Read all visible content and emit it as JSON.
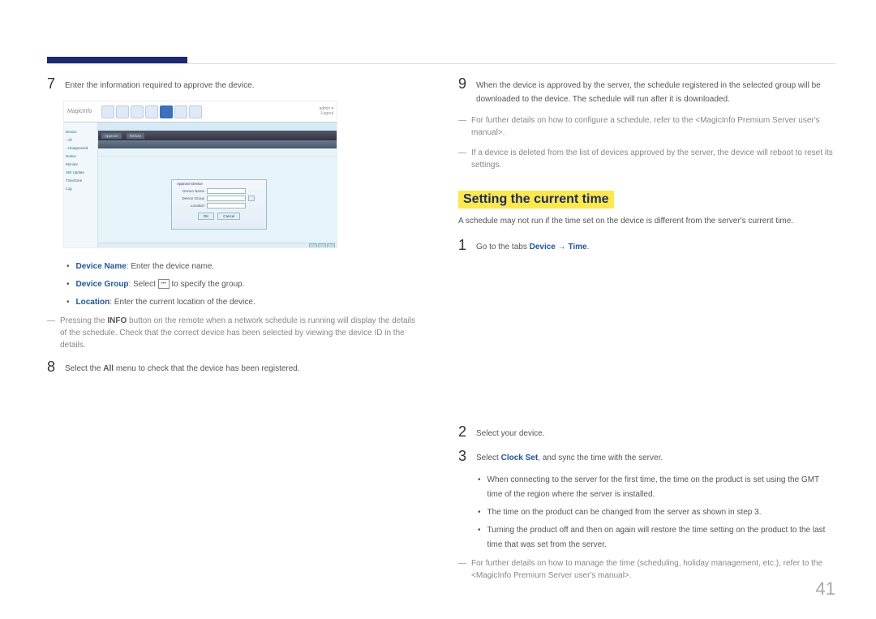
{
  "pageNumber": "41",
  "left": {
    "step7": {
      "num": "7",
      "text": "Enter the information required to approve the device."
    },
    "ss": {
      "logo": "MagicInfo",
      "sideItems": [
        "Device",
        "- All",
        "- Unapproved",
        "Notice",
        "Monitor",
        "SW Update",
        "TimeZone",
        "Log"
      ],
      "dlg": {
        "title": "Approve Device",
        "rows": [
          {
            "label": "Device Name"
          },
          {
            "label": "Device Group"
          },
          {
            "label": "Location"
          }
        ],
        "btnOk": "OK",
        "btnCancel": "Cancel"
      }
    },
    "bullets": {
      "deviceNameLabel": "Device Name",
      "deviceNameText": ": Enter the device name.",
      "deviceGroupLabel": "Device Group",
      "deviceGroupText1": ": Select ",
      "deviceGroupText2": " to specify the group.",
      "locationLabel": "Location",
      "locationText": ": Enter the current location of the device."
    },
    "note1a": "Pressing the ",
    "note1b": "INFO",
    "note1c": " button on the remote when a network schedule is running will display the details of the schedule. Check that the correct device has been selected by viewing the device ID in the details.",
    "step8": {
      "num": "8",
      "pre": "Select the ",
      "bold": "All",
      "post": " menu to check that the device has been registered."
    }
  },
  "right": {
    "step9": {
      "num": "9",
      "text": "When the device is approved by the server, the schedule registered in the selected group will be downloaded to the device. The schedule will run after it is downloaded."
    },
    "note2": "For further details on how to configure a schedule, refer to the <MagicInfo Premium Server user's manual>.",
    "note3": "If a device is deleted from the list of devices approved by the server, the device will reboot to reset its settings.",
    "sectionTitle": "Setting the current time",
    "intro": "A schedule may not run if the time set on the device is different from the server's current time.",
    "step1": {
      "num": "1",
      "pre": "Go to the tabs ",
      "b1": "Device",
      "arrow": " → ",
      "b2": "Time",
      "post": "."
    },
    "step2": {
      "num": "2",
      "text": "Select your device."
    },
    "step3": {
      "num": "3",
      "pre": "Select ",
      "bold": "Clock Set",
      "post": ", and sync the time with the server."
    },
    "sub": {
      "a": "When connecting to the server for the first time, the time on the product is set using the GMT time of the region where the server is installed.",
      "b": "The time on the product can be changed from the server as shown in step 3.",
      "c": "Turning the product off and then on again will restore the time setting on the product to the last time that was set from the server."
    },
    "note4": "For further details on how to manage the time (scheduling, holiday management, etc.), refer to the <MagicInfo Premium Server user's manual>."
  }
}
